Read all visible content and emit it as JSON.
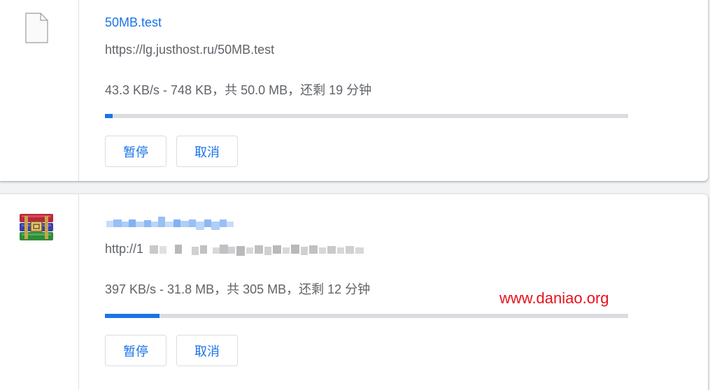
{
  "downloads": [
    {
      "file_name": "50MB.test",
      "url": "https://lg.justhost.ru/50MB.test",
      "status": "43.3 KB/s - 748 KB，共 50.0 MB，还剩 19 分钟",
      "progress": 0.015,
      "icon": "blank-file-icon",
      "pause_label": "暂停",
      "cancel_label": "取消"
    },
    {
      "file_name": "",
      "url": "http://1",
      "status": "397 KB/s - 31.8 MB，共 305 MB，还剩 12 分钟",
      "progress": 0.104,
      "icon": "winrar-archive-icon",
      "pause_label": "暂停",
      "cancel_label": "取消"
    }
  ],
  "watermark": "www.daniao.org",
  "colors": {
    "accent": "#1a73e8",
    "text_secondary": "#5f6368",
    "watermark": "#e8121c"
  }
}
